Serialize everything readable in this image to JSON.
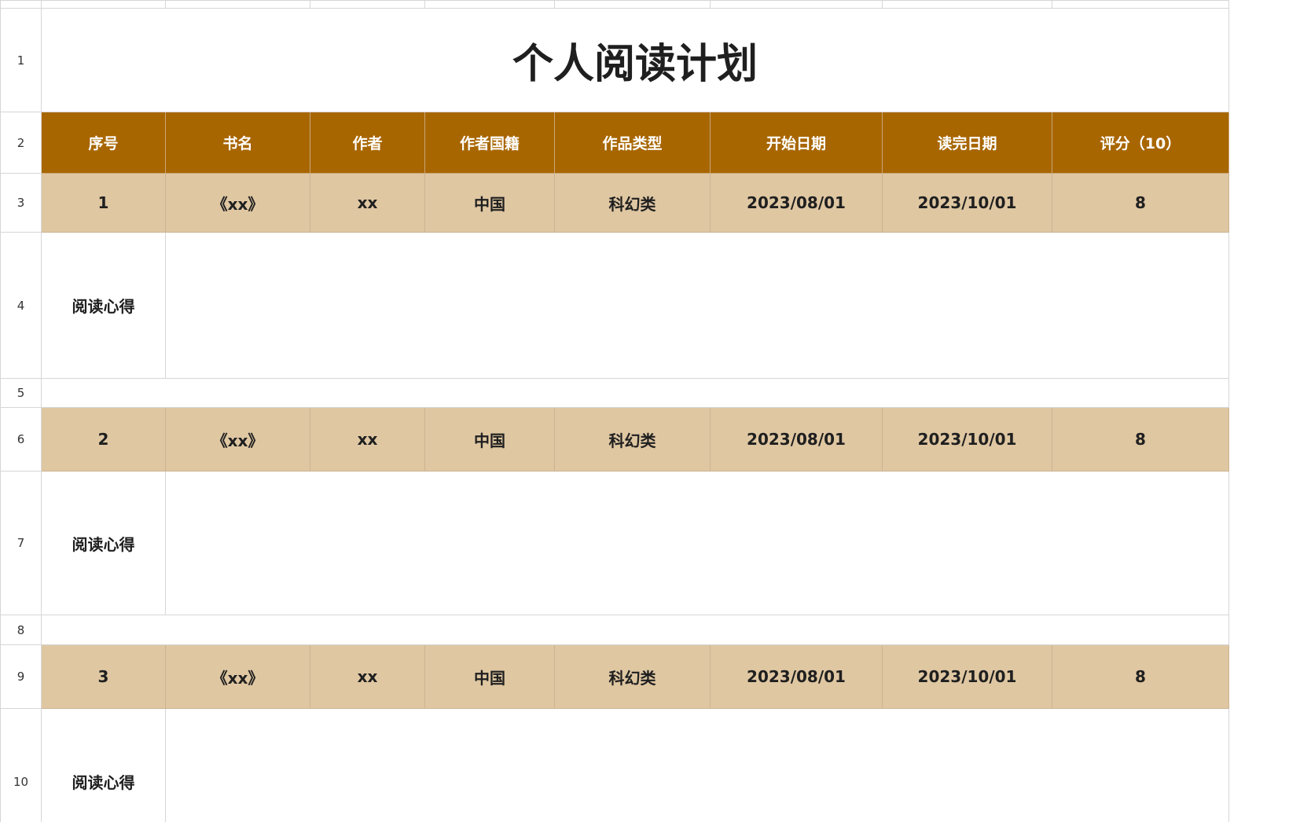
{
  "sheet": {
    "title": "个人阅读计划",
    "row_numbers": [
      "1",
      "2",
      "3",
      "4",
      "5",
      "6",
      "7",
      "8",
      "9",
      "10"
    ],
    "columns": [
      "序号",
      "书名",
      "作者",
      "作者国籍",
      "作品类型",
      "开始日期",
      "读完日期",
      "评分（10）"
    ],
    "notes_label": "阅读心得",
    "books": [
      {
        "no": "1",
        "title": "《xx》",
        "author": "xx",
        "nationality": "中国",
        "genre": "科幻类",
        "start": "2023/08/01",
        "finish": "2023/10/01",
        "score": "8"
      },
      {
        "no": "2",
        "title": "《xx》",
        "author": "xx",
        "nationality": "中国",
        "genre": "科幻类",
        "start": "2023/08/01",
        "finish": "2023/10/01",
        "score": "8"
      },
      {
        "no": "3",
        "title": "《xx》",
        "author": "xx",
        "nationality": "中国",
        "genre": "科幻类",
        "start": "2023/08/01",
        "finish": "2023/10/01",
        "score": "8"
      }
    ]
  },
  "colors": {
    "header_bg": "#a86600",
    "header_text": "#ffffff",
    "entry_bg": "#dfc7a2",
    "grid_line": "#d6d6d6"
  }
}
